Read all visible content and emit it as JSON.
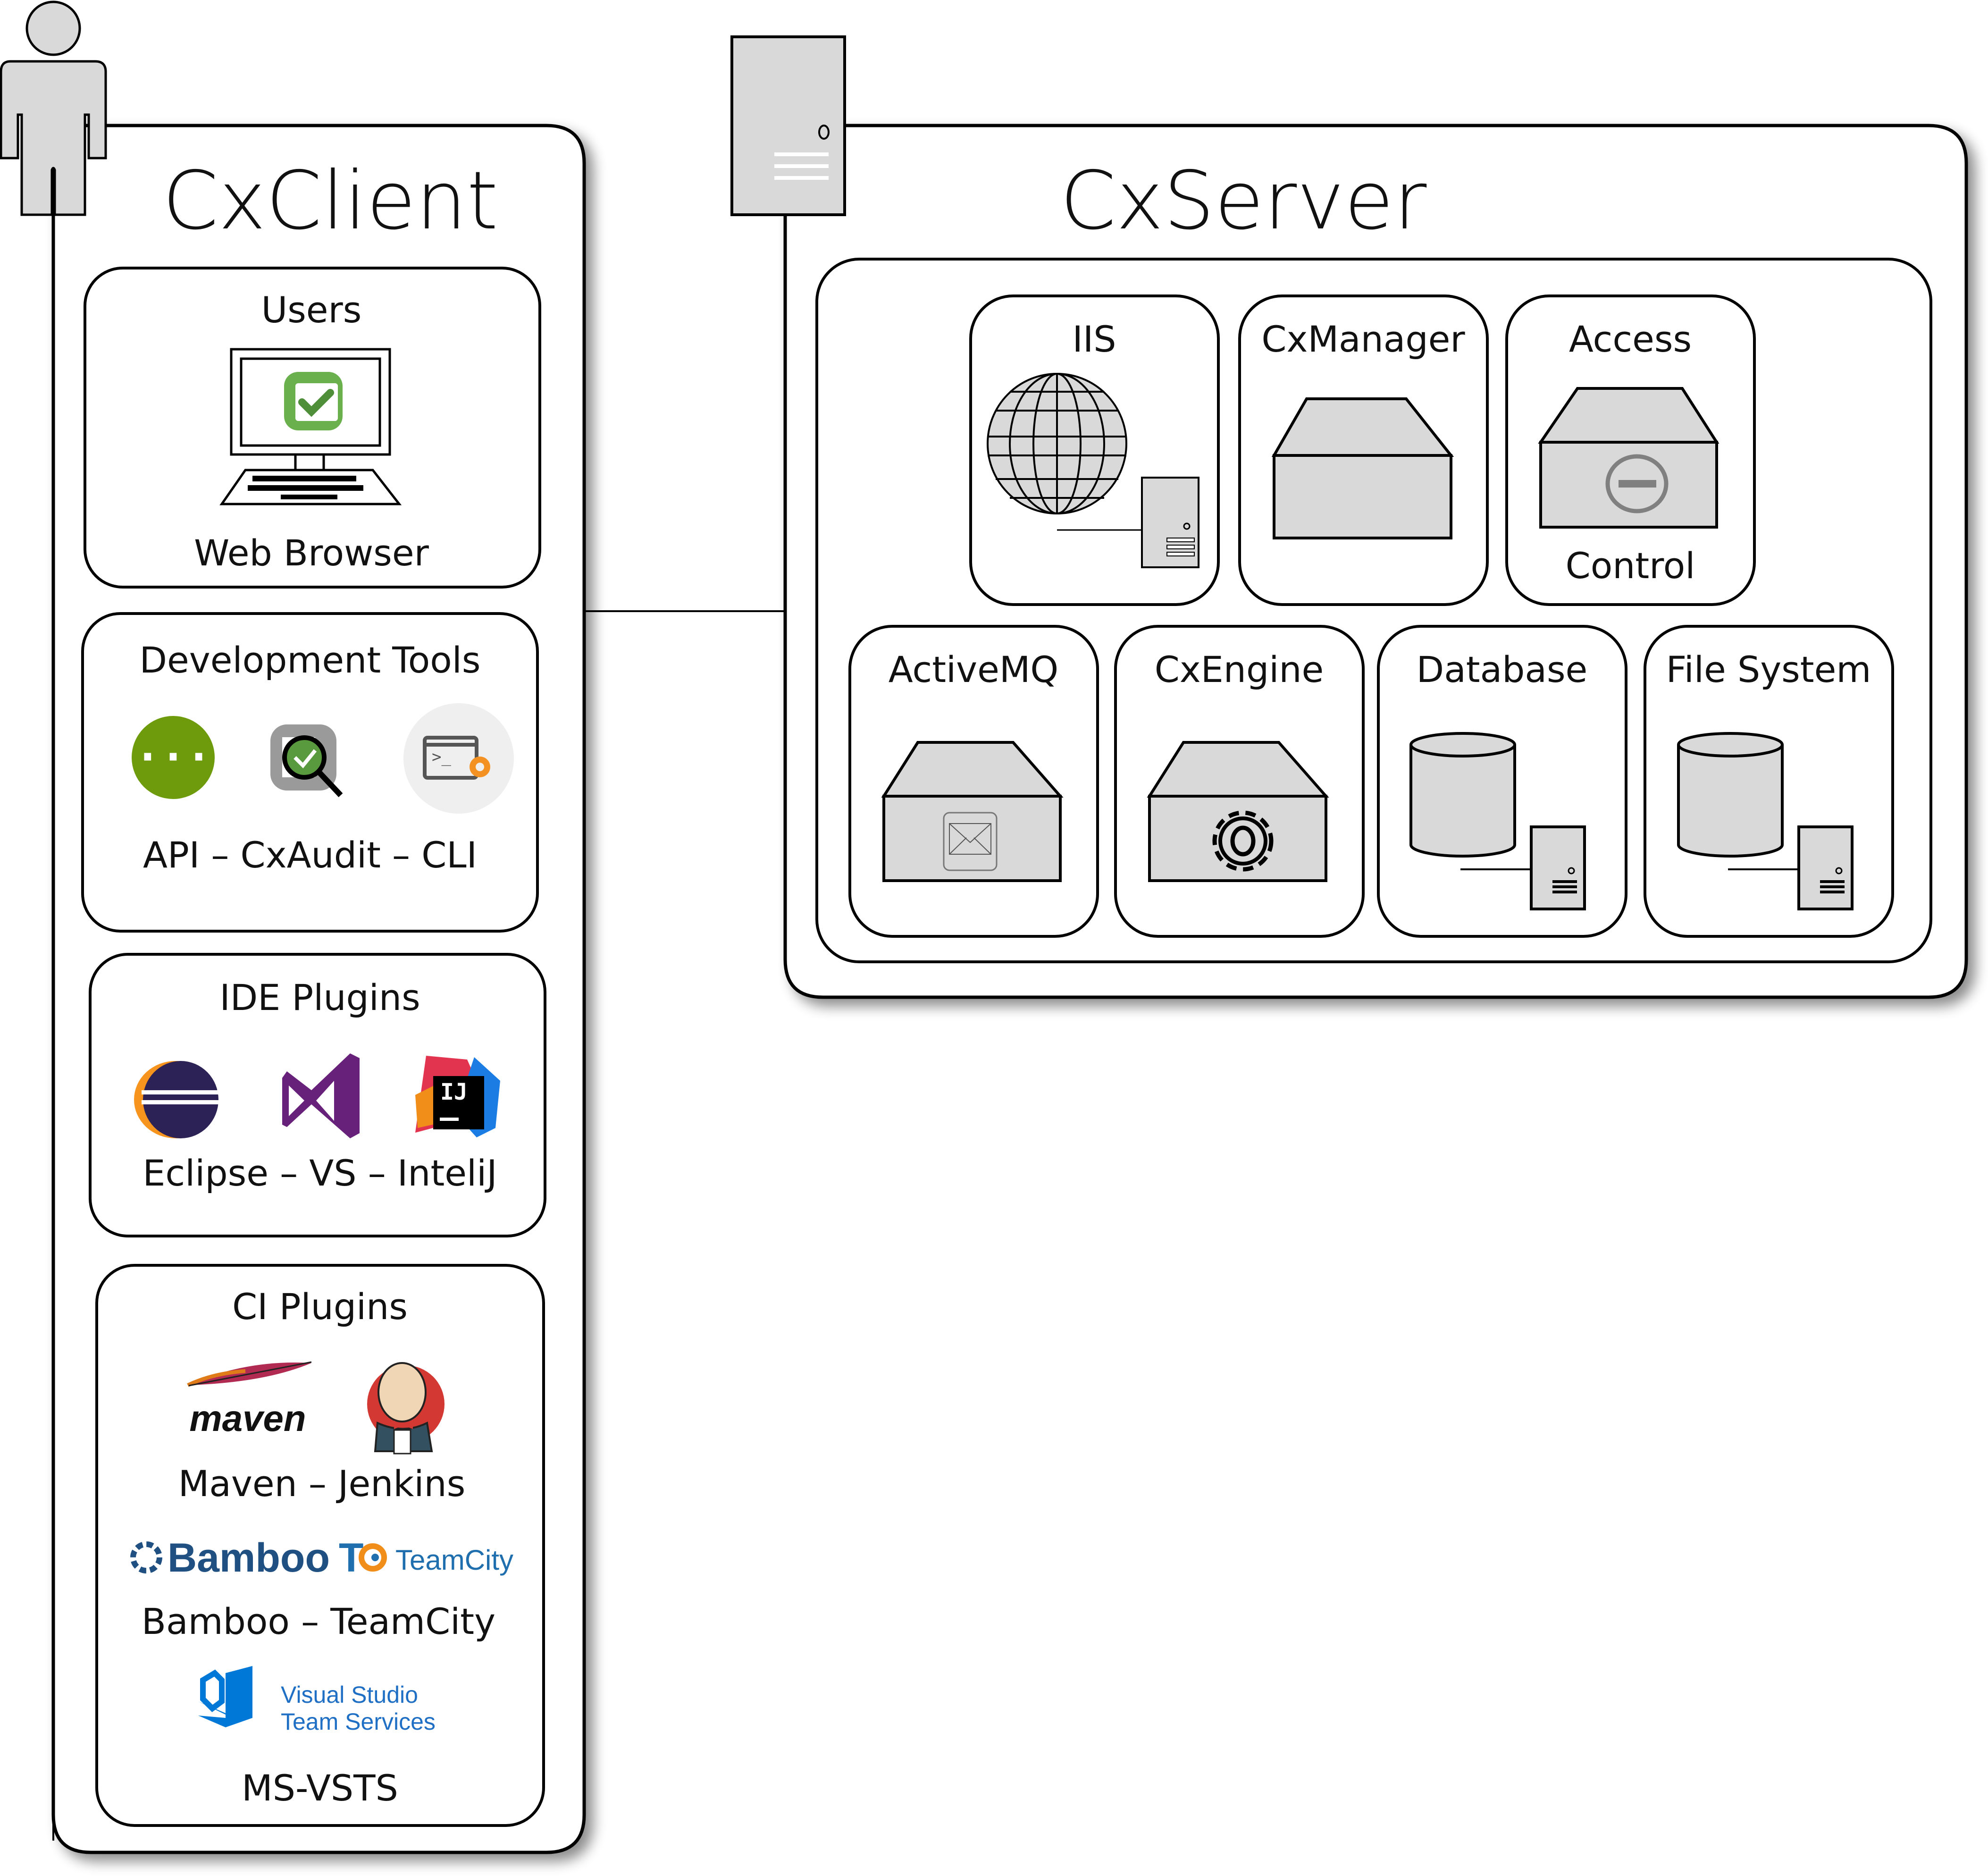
{
  "client": {
    "title": "CxClient",
    "actor_icon": "person-icon",
    "sections": {
      "users": {
        "title": "Users",
        "caption": "Web Browser",
        "icon": "computer-checkmarx-icon"
      },
      "dev_tools": {
        "title": "Development Tools",
        "caption": "API  –  CxAudit  –  CLI",
        "items": [
          {
            "label": "API",
            "icon": "swagger-api-icon",
            "color": "#6d9b0b"
          },
          {
            "label": "CxAudit",
            "icon": "cxaudit-magnifier-icon",
            "color": "#5a9a3f"
          },
          {
            "label": "CLI",
            "icon": "terminal-gear-icon",
            "color": "#f39222"
          }
        ]
      },
      "ide_plugins": {
        "title": "IDE Plugins",
        "caption": "Eclipse   –   VS   –   InteliJ",
        "items": [
          {
            "label": "Eclipse",
            "icon": "eclipse-icon",
            "color": "#2c2255"
          },
          {
            "label": "VS",
            "icon": "visual-studio-icon",
            "color": "#68217a"
          },
          {
            "label": "InteliJ",
            "icon": "intellij-icon",
            "color": "#000000"
          }
        ]
      },
      "ci_plugins": {
        "title": "CI Plugins",
        "row1_caption": "Maven  –   Jenkins",
        "row2_caption": "Bamboo   –   TeamCity",
        "row3_caption": "MS-VSTS",
        "maven_logo_text": "maven",
        "bamboo_logo_text": "Bamboo",
        "teamcity_logo_text": "TeamCity",
        "vsts_logo_line1": "Visual Studio",
        "vsts_logo_line2": "Team Services",
        "items": [
          {
            "label": "Maven",
            "icon": "maven-feather-icon",
            "color": "#e07b19"
          },
          {
            "label": "Jenkins",
            "icon": "jenkins-butler-icon",
            "color": "#d33833"
          },
          {
            "label": "Bamboo",
            "icon": "bamboo-icon",
            "color": "#205081"
          },
          {
            "label": "TeamCity",
            "icon": "teamcity-icon",
            "color": "#1f6faf"
          },
          {
            "label": "MS-VSTS",
            "icon": "vsts-icon",
            "color": "#0078d7"
          }
        ]
      }
    }
  },
  "server": {
    "title": "CxServer",
    "host_icon": "server-tower-icon",
    "components": [
      {
        "label": "IIS",
        "icon": "globe-server-icon"
      },
      {
        "label": "CxManager",
        "icon": "server-box-icon"
      },
      {
        "label": "Access",
        "caption": "Control",
        "icon": "access-control-box-icon"
      },
      {
        "label": "ActiveMQ",
        "icon": "message-queue-box-icon"
      },
      {
        "label": "CxEngine",
        "icon": "engine-gear-box-icon"
      },
      {
        "label": "Database",
        "icon": "database-cylinder-icon"
      },
      {
        "label": "File System",
        "icon": "filesystem-cylinder-icon"
      }
    ]
  },
  "colors": {
    "stroke": "#000000",
    "fill_grey": "#d9d9d9",
    "checkmarx_green": "#6ab04c"
  }
}
